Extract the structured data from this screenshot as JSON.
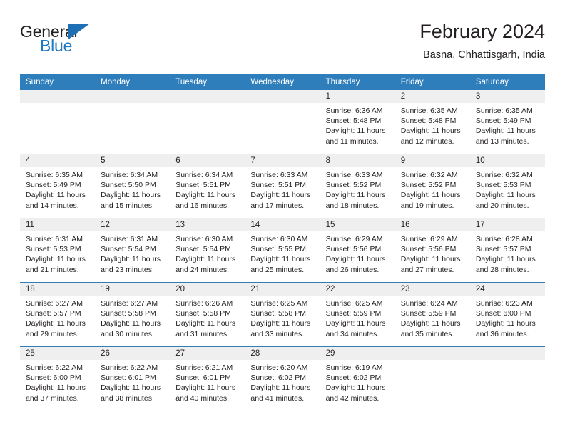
{
  "brand": {
    "name_part1": "General",
    "name_part2": "Blue",
    "accent_color": "#1f78c1"
  },
  "header": {
    "title": "February 2024",
    "subtitle": "Basna, Chhattisgarh, India"
  },
  "calendar": {
    "header_bg": "#2e7ebc",
    "daynum_bg": "#efefef",
    "weekdays": [
      "Sunday",
      "Monday",
      "Tuesday",
      "Wednesday",
      "Thursday",
      "Friday",
      "Saturday"
    ],
    "weeks": [
      [
        {
          "day": "",
          "lines": []
        },
        {
          "day": "",
          "lines": []
        },
        {
          "day": "",
          "lines": []
        },
        {
          "day": "",
          "lines": []
        },
        {
          "day": "1",
          "lines": [
            "Sunrise: 6:36 AM",
            "Sunset: 5:48 PM",
            "Daylight: 11 hours",
            "and 11 minutes."
          ]
        },
        {
          "day": "2",
          "lines": [
            "Sunrise: 6:35 AM",
            "Sunset: 5:48 PM",
            "Daylight: 11 hours",
            "and 12 minutes."
          ]
        },
        {
          "day": "3",
          "lines": [
            "Sunrise: 6:35 AM",
            "Sunset: 5:49 PM",
            "Daylight: 11 hours",
            "and 13 minutes."
          ]
        }
      ],
      [
        {
          "day": "4",
          "lines": [
            "Sunrise: 6:35 AM",
            "Sunset: 5:49 PM",
            "Daylight: 11 hours",
            "and 14 minutes."
          ]
        },
        {
          "day": "5",
          "lines": [
            "Sunrise: 6:34 AM",
            "Sunset: 5:50 PM",
            "Daylight: 11 hours",
            "and 15 minutes."
          ]
        },
        {
          "day": "6",
          "lines": [
            "Sunrise: 6:34 AM",
            "Sunset: 5:51 PM",
            "Daylight: 11 hours",
            "and 16 minutes."
          ]
        },
        {
          "day": "7",
          "lines": [
            "Sunrise: 6:33 AM",
            "Sunset: 5:51 PM",
            "Daylight: 11 hours",
            "and 17 minutes."
          ]
        },
        {
          "day": "8",
          "lines": [
            "Sunrise: 6:33 AM",
            "Sunset: 5:52 PM",
            "Daylight: 11 hours",
            "and 18 minutes."
          ]
        },
        {
          "day": "9",
          "lines": [
            "Sunrise: 6:32 AM",
            "Sunset: 5:52 PM",
            "Daylight: 11 hours",
            "and 19 minutes."
          ]
        },
        {
          "day": "10",
          "lines": [
            "Sunrise: 6:32 AM",
            "Sunset: 5:53 PM",
            "Daylight: 11 hours",
            "and 20 minutes."
          ]
        }
      ],
      [
        {
          "day": "11",
          "lines": [
            "Sunrise: 6:31 AM",
            "Sunset: 5:53 PM",
            "Daylight: 11 hours",
            "and 21 minutes."
          ]
        },
        {
          "day": "12",
          "lines": [
            "Sunrise: 6:31 AM",
            "Sunset: 5:54 PM",
            "Daylight: 11 hours",
            "and 23 minutes."
          ]
        },
        {
          "day": "13",
          "lines": [
            "Sunrise: 6:30 AM",
            "Sunset: 5:54 PM",
            "Daylight: 11 hours",
            "and 24 minutes."
          ]
        },
        {
          "day": "14",
          "lines": [
            "Sunrise: 6:30 AM",
            "Sunset: 5:55 PM",
            "Daylight: 11 hours",
            "and 25 minutes."
          ]
        },
        {
          "day": "15",
          "lines": [
            "Sunrise: 6:29 AM",
            "Sunset: 5:56 PM",
            "Daylight: 11 hours",
            "and 26 minutes."
          ]
        },
        {
          "day": "16",
          "lines": [
            "Sunrise: 6:29 AM",
            "Sunset: 5:56 PM",
            "Daylight: 11 hours",
            "and 27 minutes."
          ]
        },
        {
          "day": "17",
          "lines": [
            "Sunrise: 6:28 AM",
            "Sunset: 5:57 PM",
            "Daylight: 11 hours",
            "and 28 minutes."
          ]
        }
      ],
      [
        {
          "day": "18",
          "lines": [
            "Sunrise: 6:27 AM",
            "Sunset: 5:57 PM",
            "Daylight: 11 hours",
            "and 29 minutes."
          ]
        },
        {
          "day": "19",
          "lines": [
            "Sunrise: 6:27 AM",
            "Sunset: 5:58 PM",
            "Daylight: 11 hours",
            "and 30 minutes."
          ]
        },
        {
          "day": "20",
          "lines": [
            "Sunrise: 6:26 AM",
            "Sunset: 5:58 PM",
            "Daylight: 11 hours",
            "and 31 minutes."
          ]
        },
        {
          "day": "21",
          "lines": [
            "Sunrise: 6:25 AM",
            "Sunset: 5:58 PM",
            "Daylight: 11 hours",
            "and 33 minutes."
          ]
        },
        {
          "day": "22",
          "lines": [
            "Sunrise: 6:25 AM",
            "Sunset: 5:59 PM",
            "Daylight: 11 hours",
            "and 34 minutes."
          ]
        },
        {
          "day": "23",
          "lines": [
            "Sunrise: 6:24 AM",
            "Sunset: 5:59 PM",
            "Daylight: 11 hours",
            "and 35 minutes."
          ]
        },
        {
          "day": "24",
          "lines": [
            "Sunrise: 6:23 AM",
            "Sunset: 6:00 PM",
            "Daylight: 11 hours",
            "and 36 minutes."
          ]
        }
      ],
      [
        {
          "day": "25",
          "lines": [
            "Sunrise: 6:22 AM",
            "Sunset: 6:00 PM",
            "Daylight: 11 hours",
            "and 37 minutes."
          ]
        },
        {
          "day": "26",
          "lines": [
            "Sunrise: 6:22 AM",
            "Sunset: 6:01 PM",
            "Daylight: 11 hours",
            "and 38 minutes."
          ]
        },
        {
          "day": "27",
          "lines": [
            "Sunrise: 6:21 AM",
            "Sunset: 6:01 PM",
            "Daylight: 11 hours",
            "and 40 minutes."
          ]
        },
        {
          "day": "28",
          "lines": [
            "Sunrise: 6:20 AM",
            "Sunset: 6:02 PM",
            "Daylight: 11 hours",
            "and 41 minutes."
          ]
        },
        {
          "day": "29",
          "lines": [
            "Sunrise: 6:19 AM",
            "Sunset: 6:02 PM",
            "Daylight: 11 hours",
            "and 42 minutes."
          ]
        },
        {
          "day": "",
          "lines": []
        },
        {
          "day": "",
          "lines": []
        }
      ]
    ]
  }
}
